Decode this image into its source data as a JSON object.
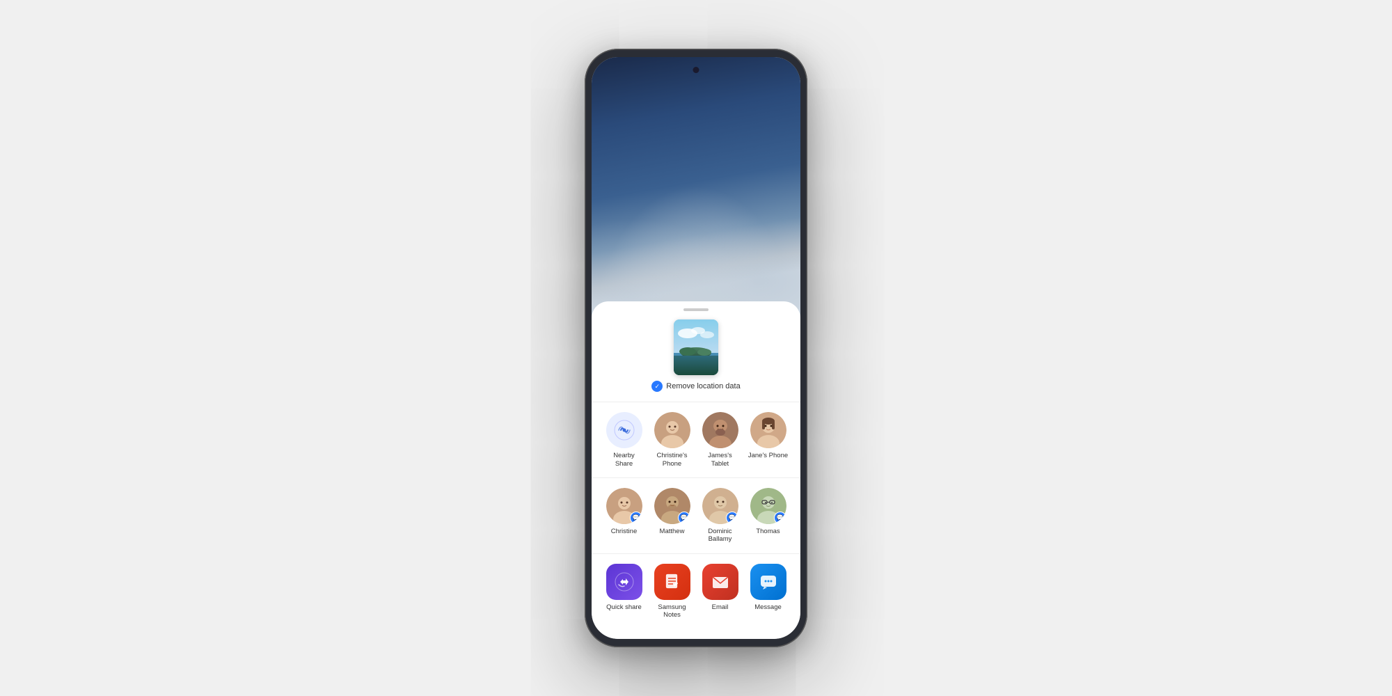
{
  "phone": {
    "wallpaper_alt": "Cloudy sky wallpaper"
  },
  "share_sheet": {
    "handle_label": "",
    "preview_alt": "Landscape photo",
    "remove_location_label": "Remove location data",
    "nearby_share": {
      "label": "Nearby Share"
    },
    "quick_contacts": [
      {
        "id": "christines-phone",
        "label": "Christine's\nPhone",
        "avatar_color": "#c8a080",
        "has_badge": false
      },
      {
        "id": "james-tablet",
        "label": "James's\nTablet",
        "avatar_color": "#b08060",
        "has_badge": false
      },
      {
        "id": "janes-phone",
        "label": "Jane's Phone",
        "avatar_color": "#e0c0a0",
        "has_badge": false
      }
    ],
    "message_contacts": [
      {
        "id": "christine",
        "label": "Christine",
        "avatar_color": "#c8a080",
        "has_badge": true
      },
      {
        "id": "matthew",
        "label": "Matthew",
        "avatar_color": "#b08060",
        "has_badge": true
      },
      {
        "id": "dominic-ballamy",
        "label": "Dominic\nBallamy",
        "avatar_color": "#d0b090",
        "has_badge": true
      },
      {
        "id": "thomas",
        "label": "Thomas",
        "avatar_color": "#a0b890",
        "has_badge": true
      }
    ],
    "apps": [
      {
        "id": "quick-share",
        "label": "Quick share",
        "color_class": "app-quick-share",
        "icon": "⇄"
      },
      {
        "id": "samsung-notes",
        "label": "Samsung\nNotes",
        "color_class": "app-samsung-notes",
        "icon": "📝"
      },
      {
        "id": "email",
        "label": "Email",
        "color_class": "app-email",
        "icon": "✉"
      },
      {
        "id": "message",
        "label": "Message",
        "color_class": "app-message",
        "icon": "💬"
      }
    ]
  }
}
